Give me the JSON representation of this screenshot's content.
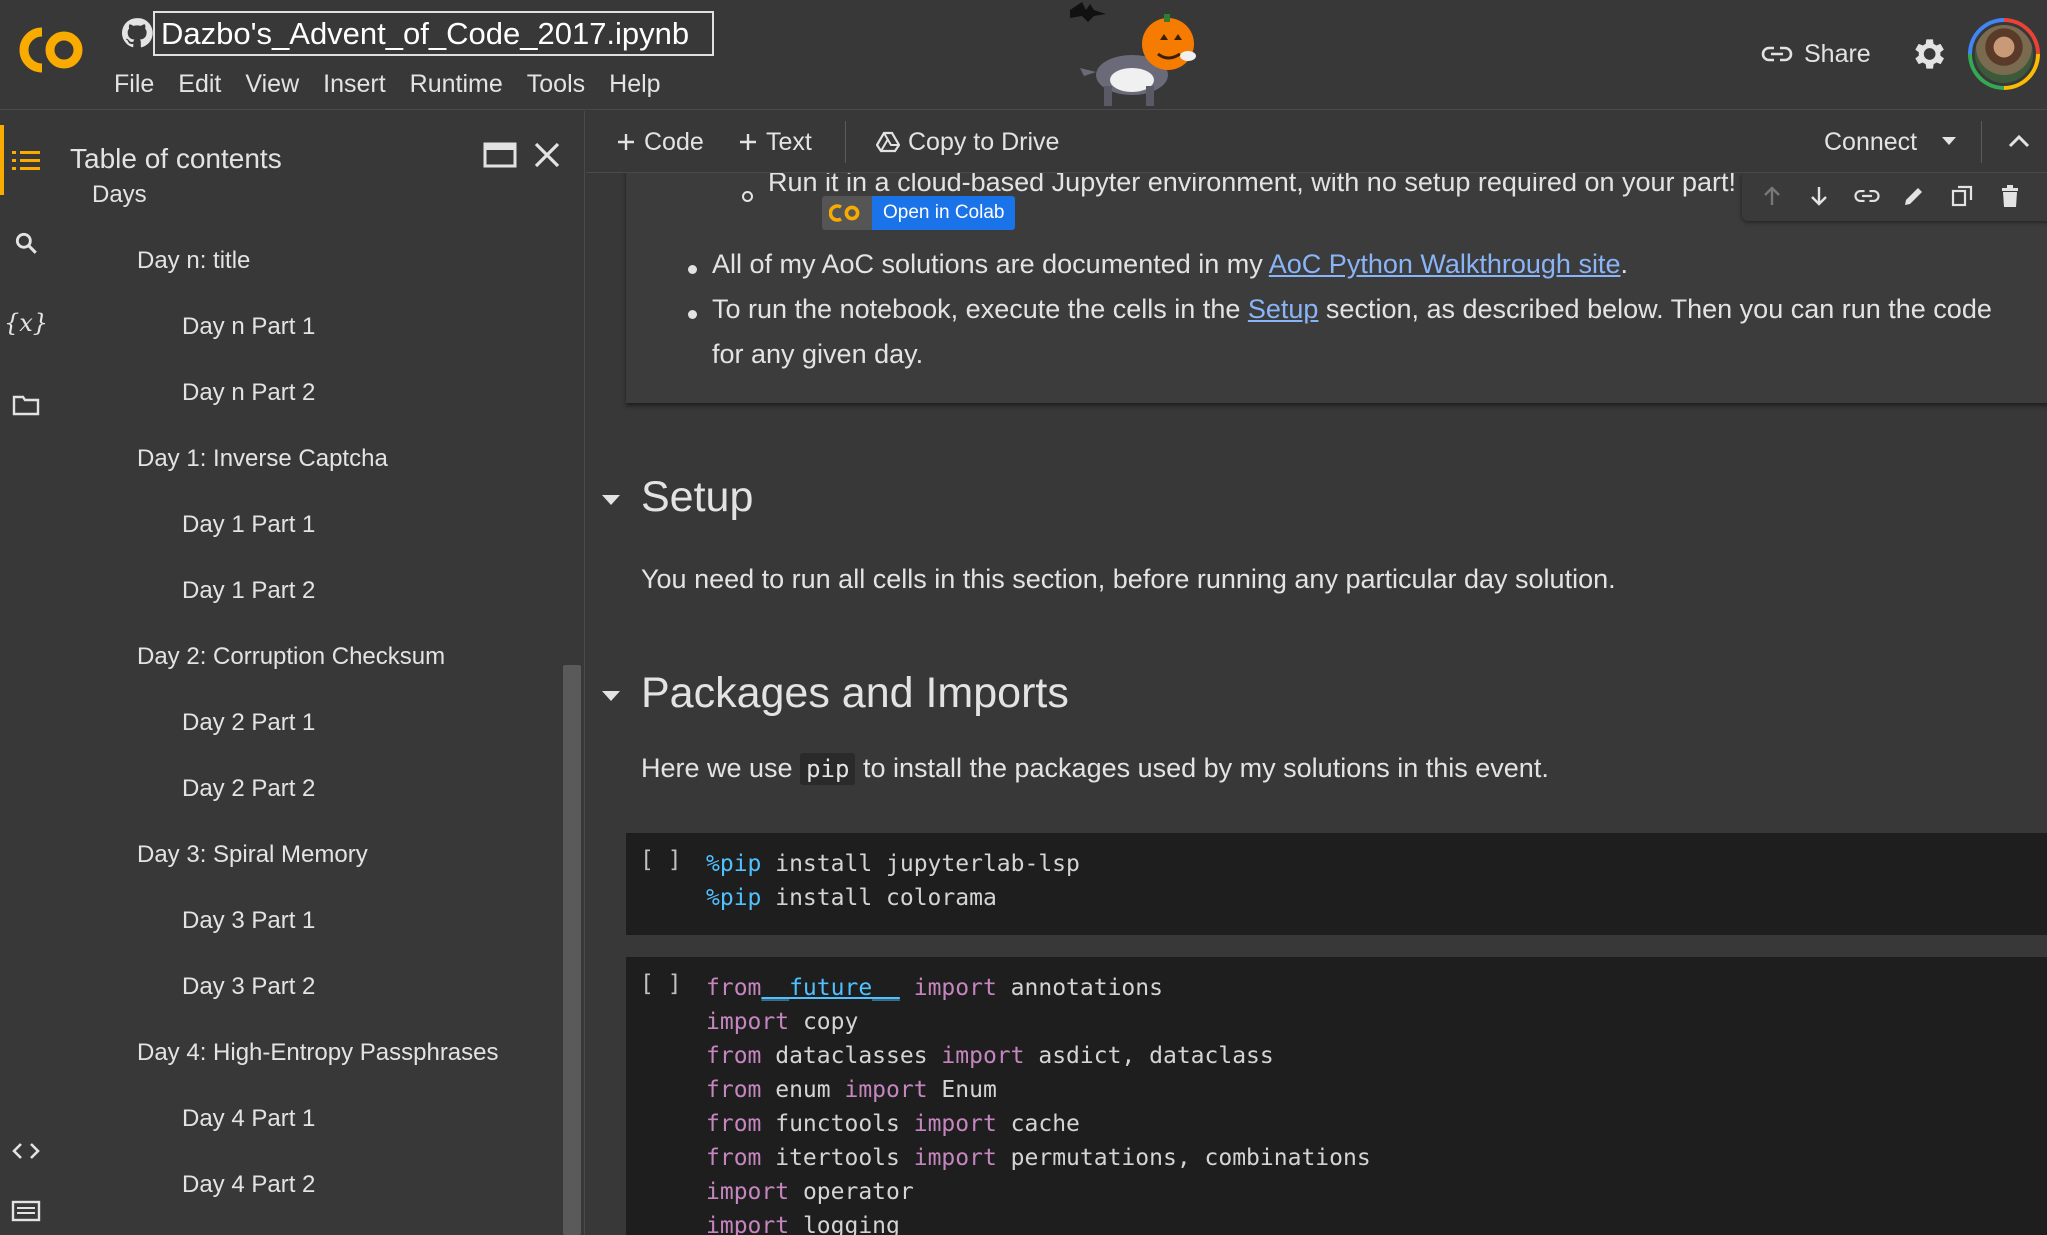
{
  "header": {
    "notebook_title": "Dazbo's_Advent_of_Code_2017.ipynb",
    "menu": [
      "File",
      "Edit",
      "View",
      "Insert",
      "Runtime",
      "Tools",
      "Help"
    ],
    "share_label": "Share"
  },
  "toc": {
    "title": "Table of contents",
    "items": [
      {
        "label": "Days",
        "level": 1
      },
      {
        "label": "Day n: title",
        "level": 2
      },
      {
        "label": "Day n Part 1",
        "level": 3
      },
      {
        "label": "Day n Part 2",
        "level": 3
      },
      {
        "label": "Day 1: Inverse Captcha",
        "level": 2
      },
      {
        "label": "Day 1 Part 1",
        "level": 3
      },
      {
        "label": "Day 1 Part 2",
        "level": 3
      },
      {
        "label": "Day 2: Corruption Checksum",
        "level": 2
      },
      {
        "label": "Day 2 Part 1",
        "level": 3
      },
      {
        "label": "Day 2 Part 2",
        "level": 3
      },
      {
        "label": "Day 3: Spiral Memory",
        "level": 2
      },
      {
        "label": "Day 3 Part 1",
        "level": 3
      },
      {
        "label": "Day 3 Part 2",
        "level": 3
      },
      {
        "label": "Day 4: High-Entropy Passphrases",
        "level": 2
      },
      {
        "label": "Day 4 Part 1",
        "level": 3
      },
      {
        "label": "Day 4 Part 2",
        "level": 3
      }
    ]
  },
  "toolbar": {
    "code_label": "Code",
    "text_label": "Text",
    "copy_label": "Copy to Drive",
    "connect_label": "Connect"
  },
  "text_cell": {
    "line1": "Run it in a cloud-based Jupyter environment, with no setup required on your part! For example",
    "badge_label": "Open in Colab",
    "bullet1_pre": "All of my AoC solutions are documented in my ",
    "bullet1_link": "AoC Python Walkthrough site",
    "bullet1_post": ".",
    "bullet2_pre": "To run the notebook, execute the cells in the ",
    "bullet2_link": "Setup",
    "bullet2_post": " section, as described below. Then you can run the code",
    "bullet2_line2": "for any given day."
  },
  "setup": {
    "heading": "Setup",
    "text": "You need to run all cells in this section, before running any particular day solution."
  },
  "packages": {
    "heading": "Packages and Imports",
    "text_pre": "Here we use ",
    "text_code": "pip",
    "text_post": " to install the packages used by my solutions in this event."
  },
  "code_cells": {
    "run_label": "[ ]",
    "cell1": [
      {
        "kw": "%pip",
        "rest": " install jupyterlab-lsp"
      },
      {
        "kw": "%pip",
        "rest": " install colorama"
      }
    ],
    "cell2": [
      {
        "kw": "from",
        "mid": "__future__",
        "kw2": " import",
        "rest": " annotations"
      },
      {
        "kw": "import",
        "rest": " copy"
      },
      {
        "kw": "from",
        "rest": " dataclasses",
        "kw2": " import",
        "rest2": " asdict, dataclass"
      },
      {
        "kw": "from",
        "rest": " enum",
        "kw2": " import",
        "rest2": " Enum"
      },
      {
        "kw": "from",
        "rest": " functools",
        "kw2": " import",
        "rest2": " cache"
      },
      {
        "kw": "from",
        "rest": " itertools",
        "kw2": " import",
        "rest2": " permutations, combinations"
      },
      {
        "kw": "import",
        "rest": " operator"
      },
      {
        "kw": "import",
        "rest": " logging"
      }
    ]
  },
  "colors": {
    "accent": "#f9ab00",
    "link": "#8ab4f8",
    "badge": "#1a73e8",
    "keyword": "#c586c0",
    "magic": "#4fc1ff"
  }
}
